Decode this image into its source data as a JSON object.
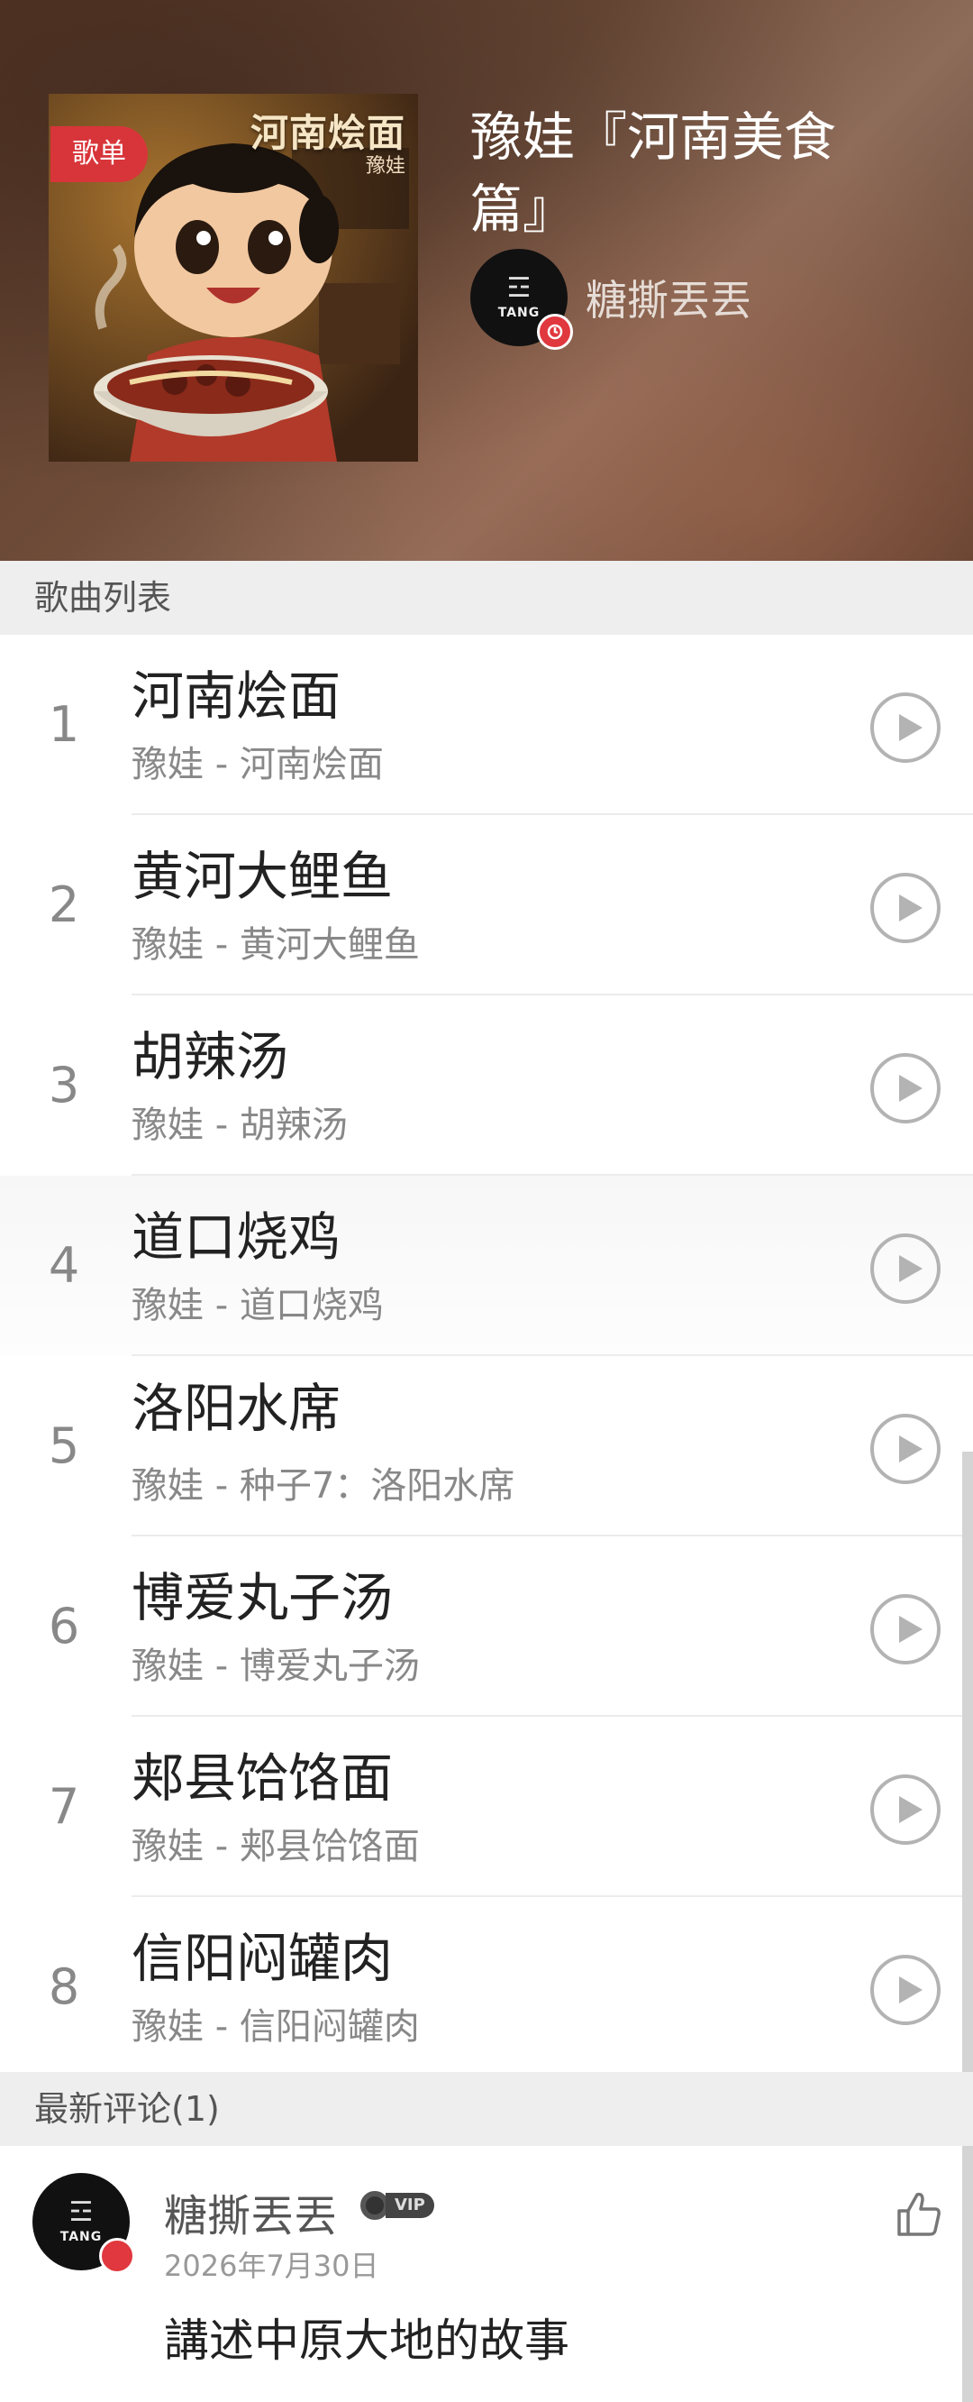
{
  "header": {
    "cover": {
      "tag": "歌单",
      "title": "河南烩面",
      "subtitle": "豫娃"
    },
    "playlist_title": "豫娃『河南美食篇』",
    "creator": {
      "name": "糖撕丟丟",
      "avatar_brand": "TANG"
    }
  },
  "song_list": {
    "header": "歌曲列表",
    "songs": [
      {
        "num": "1",
        "title": "河南烩面",
        "subtitle": "豫娃 - 河南烩面"
      },
      {
        "num": "2",
        "title": "黄河大鲤鱼",
        "subtitle": "豫娃 - 黄河大鲤鱼"
      },
      {
        "num": "3",
        "title": "胡辣汤",
        "subtitle": "豫娃 - 胡辣汤"
      },
      {
        "num": "4",
        "title": "道口烧鸡",
        "subtitle": "豫娃 - 道口烧鸡"
      },
      {
        "num": "5",
        "title": "洛阳水席",
        "subtitle": "豫娃 - 种子7：洛阳水席"
      },
      {
        "num": "6",
        "title": "博爱丸子汤",
        "subtitle": "豫娃 - 博爱丸子汤"
      },
      {
        "num": "7",
        "title": "郏县饸饹面",
        "subtitle": "豫娃 - 郏县饸饹面"
      },
      {
        "num": "8",
        "title": "信阳闷罐肉",
        "subtitle": "豫娃 - 信阳闷罐肉"
      }
    ]
  },
  "comments": {
    "header": "最新评论(1)",
    "items": [
      {
        "user": "糖撕丟丟",
        "badge": "VIP",
        "avatar_brand": "TANG",
        "date": "2026年7月30日",
        "text": "講述中原大地的故事"
      }
    ]
  },
  "colors": {
    "accent_red": "#d8353a",
    "section_bg": "#eeeeee",
    "play_icon": "#b3b3b3"
  },
  "icons": {
    "play": "play-circle-icon",
    "like": "thumbs-up-icon",
    "avatar_badge": "music-badge-icon"
  }
}
